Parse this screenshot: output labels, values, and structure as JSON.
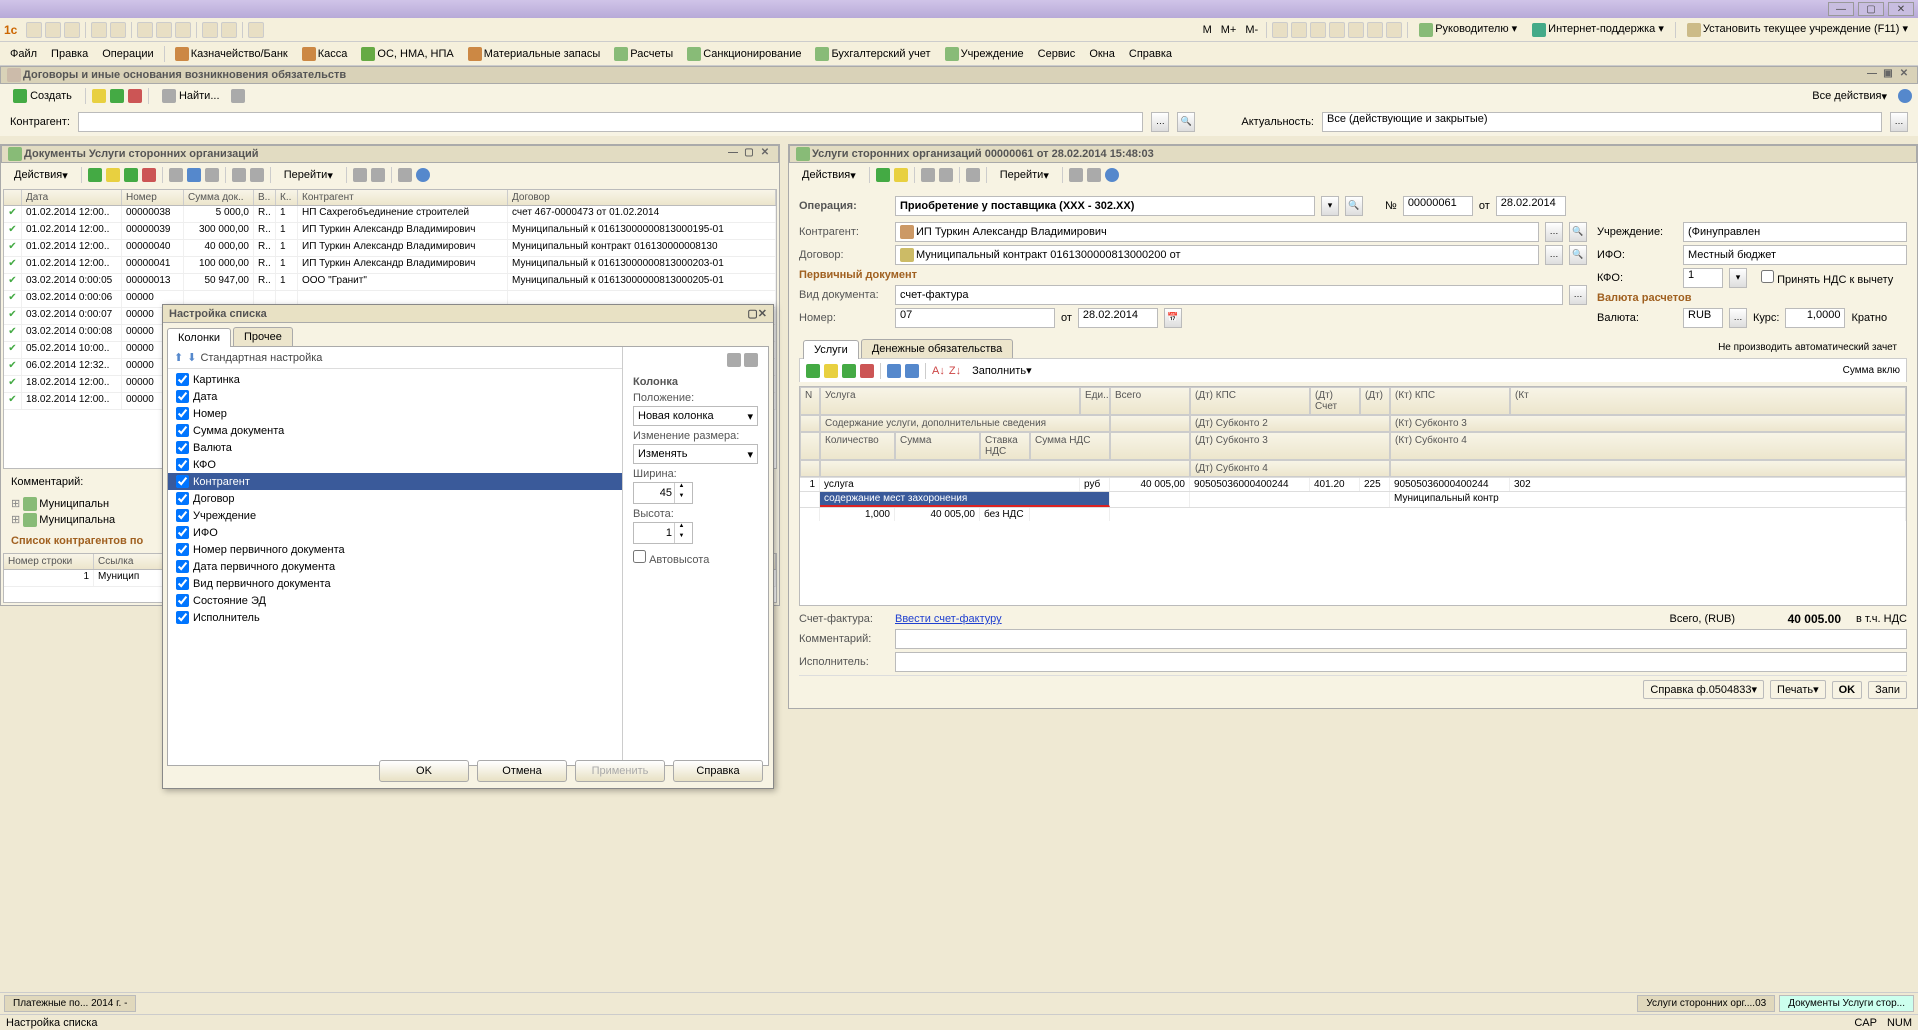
{
  "titlebar": {
    "logo": "1c"
  },
  "menus": {
    "toolbar_icons": [
      "new",
      "open",
      "save",
      "print",
      "preview",
      "sep",
      "copy",
      "cut",
      "paste",
      "sep",
      "undo",
      "redo"
    ],
    "role_links": [
      {
        "icon": "user",
        "label": "Руководителю"
      },
      {
        "icon": "globe",
        "label": "Интернет-поддержка"
      },
      {
        "icon": "box",
        "label": "Установить текущее учреждение (F11)"
      }
    ],
    "main": [
      "Файл",
      "Правка",
      "Операции"
    ],
    "sections": [
      {
        "icon": "bank",
        "label": "Казначейство/Банк"
      },
      {
        "icon": "cash",
        "label": "Касса"
      },
      {
        "icon": "os",
        "label": "ОС, НМА, НПА"
      },
      {
        "icon": "mat",
        "label": "Материальные запасы"
      },
      {
        "icon": "calc",
        "label": "Расчеты"
      },
      {
        "icon": "sanc",
        "label": "Санкционирование"
      },
      {
        "icon": "acc",
        "label": "Бухгалтерский учет"
      },
      {
        "icon": "inst",
        "label": "Учреждение"
      },
      {
        "icon": "svc",
        "label": "Сервис"
      },
      {
        "icon": "win",
        "label": "Окна"
      },
      {
        "icon": "help",
        "label": "Справка"
      }
    ]
  },
  "main_window": {
    "title": "Договоры и иные основания возникновения обязательств",
    "create": "Создать",
    "find": "Найти...",
    "all_actions": "Все действия",
    "filter_contragent_label": "Контрагент:",
    "filter_relevance_label": "Актуальность:",
    "filter_relevance_value": "Все (действующие и закрытые)"
  },
  "doc_list": {
    "title": "Документы Услуги сторонних организаций",
    "actions_label": "Действия",
    "goto_label": "Перейти",
    "headers": [
      "",
      "Дата",
      "Номер",
      "Сумма док..",
      "В..",
      "К..",
      "Контрагент",
      "Договор"
    ],
    "rows": [
      {
        "date": "01.02.2014 12:00..",
        "num": "00000038",
        "sum": "5 000,0",
        "v": "R..",
        "k": "1",
        "ctr": "НП Саxрегобъединение строителей",
        "dog": "счет 467-0000473 от 01.02.2014"
      },
      {
        "date": "01.02.2014 12:00..",
        "num": "00000039",
        "sum": "300 000,00",
        "v": "R..",
        "k": "1",
        "ctr": "ИП Туркин Александр Владимирович",
        "dog": "Муниципальный к 01613000000813000195-01"
      },
      {
        "date": "01.02.2014 12:00..",
        "num": "00000040",
        "sum": "40 000,00",
        "v": "R..",
        "k": "1",
        "ctr": "ИП Туркин Александр Владимирович",
        "dog": "Муниципальный контракт 016130000008130"
      },
      {
        "date": "01.02.2014 12:00..",
        "num": "00000041",
        "sum": "100 000,00",
        "v": "R..",
        "k": "1",
        "ctr": "ИП Туркин Александр Владимирович",
        "dog": "Муниципальный к 01613000000813000203-01"
      },
      {
        "date": "03.02.2014 0:00:05",
        "num": "00000013",
        "sum": "50 947,00",
        "v": "R..",
        "k": "1",
        "ctr": "ООО \"Гранит\"",
        "dog": "Муниципальный к 01613000000813000205-01"
      },
      {
        "date": "03.02.2014 0:00:06",
        "num": "00000",
        "sum": "",
        "v": "",
        "k": "",
        "ctr": "",
        "dog": ""
      },
      {
        "date": "03.02.2014 0:00:07",
        "num": "00000",
        "sum": "",
        "v": "",
        "k": "",
        "ctr": "",
        "dog": ""
      },
      {
        "date": "03.02.2014 0:00:08",
        "num": "00000",
        "sum": "",
        "v": "",
        "k": "",
        "ctr": "",
        "dog": ""
      },
      {
        "date": "05.02.2014 10:00..",
        "num": "00000",
        "sum": "",
        "v": "",
        "k": "",
        "ctr": "",
        "dog": ""
      },
      {
        "date": "06.02.2014 12:32..",
        "num": "00000",
        "sum": "",
        "v": "",
        "k": "",
        "ctr": "",
        "dog": ""
      },
      {
        "date": "18.02.2014 12:00..",
        "num": "00000",
        "sum": "",
        "v": "",
        "k": "",
        "ctr": "",
        "dog": ""
      },
      {
        "date": "18.02.2014 12:00..",
        "num": "00000",
        "sum": "",
        "v": "",
        "k": "",
        "ctr": "",
        "dog": ""
      }
    ],
    "comment_label": "Комментарий:",
    "tree_items": [
      "Муниципальн",
      "Муниципальна"
    ],
    "ctr_list_label": "Список контрагентов по",
    "ctr_headers": [
      "Номер строки",
      "Ссылка"
    ],
    "ctr_rows": [
      {
        "n": "1",
        "ref": "Муницип"
      }
    ]
  },
  "dlg": {
    "title": "Настройка списка",
    "tabs": [
      "Колонки",
      "Прочее"
    ],
    "std_setup": "Стандартная настройка",
    "columns": [
      {
        "checked": true,
        "label": "Картинка"
      },
      {
        "checked": true,
        "label": "Дата"
      },
      {
        "checked": true,
        "label": "Номер"
      },
      {
        "checked": true,
        "label": "Сумма документа"
      },
      {
        "checked": true,
        "label": "Валюта"
      },
      {
        "checked": true,
        "label": "КФО"
      },
      {
        "checked": true,
        "label": "Контрагент",
        "selected": true
      },
      {
        "checked": true,
        "label": "Договор"
      },
      {
        "checked": true,
        "label": "Учреждение"
      },
      {
        "checked": true,
        "label": "ИФО"
      },
      {
        "checked": true,
        "label": "Номер первичного документа"
      },
      {
        "checked": true,
        "label": "Дата первичного документа"
      },
      {
        "checked": true,
        "label": "Вид первичного документа"
      },
      {
        "checked": true,
        "label": "Состояние ЭД"
      },
      {
        "checked": true,
        "label": "Исполнитель"
      }
    ],
    "col_section": "Колонка",
    "prop_position": "Положение:",
    "prop_position_val": "Новая колонка",
    "prop_resize": "Изменение размера:",
    "prop_resize_val": "Изменять",
    "prop_width": "Ширина:",
    "prop_width_val": "45",
    "prop_height": "Высота:",
    "prop_height_val": "1",
    "prop_autoheight": "Автовысота",
    "btns": {
      "ok": "OK",
      "cancel": "Отмена",
      "apply": "Применить",
      "help": "Справка"
    }
  },
  "detail": {
    "title": "Услуги сторонних организаций 00000061 от 28.02.2014 15:48:03",
    "actions_label": "Действия",
    "goto_label": "Перейти",
    "op_label": "Операция:",
    "op_value": "Приобретение у поставщика (XXX - 302.XX)",
    "num_label": "№",
    "num_value": "00000061",
    "from_label": "от",
    "from_value": "28.02.2014",
    "ctr_label": "Контрагент:",
    "ctr_value": "ИП Туркин Александр Владимирович",
    "inst_label": "Учреждение:",
    "inst_value": "(Финуправлен",
    "dog_label": "Договор:",
    "dog_value": "Муниципальный контракт 0161300000813000200 от",
    "ifo_label": "ИФО:",
    "ifo_value": "Местный бюджет",
    "prim_doc_section": "Первичный документ",
    "doc_type_label": "Вид документа:",
    "doc_type_value": "счет-фактура",
    "num2_label": "Номер:",
    "num2_value": "07",
    "from2_label": "от",
    "from2_value": "28.02.2014",
    "kfo_label": "КФО:",
    "kfo_value": "1",
    "nds_accept": "Принять НДС к вычету",
    "currency_section": "Валюта расчетов",
    "currency_label": "Валюта:",
    "currency_value": "RUB",
    "rate_label": "Курс:",
    "rate_value": "1,0000",
    "mult_label": "Кратно",
    "tabs": [
      "Услуги",
      "Денежные обязательства"
    ],
    "fill_label": "Заполнить",
    "no_auto_offset": "Не производить автоматический зачет",
    "sum_incl": "Сумма вклю",
    "grid_headers": {
      "n": "N",
      "svc": "Услуга",
      "unit": "Еди..",
      "total": "Всего",
      "dt_kps": "(Дт) КПС",
      "dt_acc": "(Дт) Счет",
      "dt": "(Дт)",
      "kt_kps": "(Кт) КПС",
      "kt": "(Кт",
      "desc": "Содержание услуги, дополнительные сведения",
      "qty": "Количество",
      "sum": "Сумма",
      "vat_rate": "Ставка НДС",
      "vat_sum": "Сумма НДС",
      "dt_sub2": "(Дт) Субконто 2",
      "kt_sub3": "(Кт) Субконто 3",
      "dt_sub3": "(Дт) Субконто 3",
      "kt_sub4": "(Кт) Субконто 4",
      "dt_sub4": "(Дт) Субконто 4"
    },
    "grid_row": {
      "n": "1",
      "svc": "услуга",
      "unit": "руб",
      "total": "40 005,00",
      "dt_kps": "90505036000400244",
      "dt_acc": "401.20",
      "dt": "225",
      "kt_kps": "90505036000400244",
      "kt": "302",
      "desc": "содержание мест захоронения",
      "qty": "1,000",
      "sum": "40 005,00",
      "vat_rate": "без НДС",
      "kt_sub3": "Муниципальный контр"
    },
    "invoice_label": "Счет-фактура:",
    "invoice_link": "Ввести счет-фактуру",
    "total_label": "Всего, (RUB)",
    "total_value": "40 005.00",
    "incl_vat": "в т.ч. НДС",
    "comment_label": "Комментарий:",
    "executor_label": "Исполнитель:",
    "ref_label": "Справка ф.0504833",
    "print_label": "Печать",
    "ok_label": "OK",
    "write_label": "Запи"
  },
  "bottom_tabs": [
    "Платежные по... 2014 г. -",
    "Услуги сторонних орг....03",
    "Документы Услуги стор..."
  ],
  "status": {
    "left": "Настройка списка",
    "cap": "CAP",
    "num": "NUM"
  }
}
